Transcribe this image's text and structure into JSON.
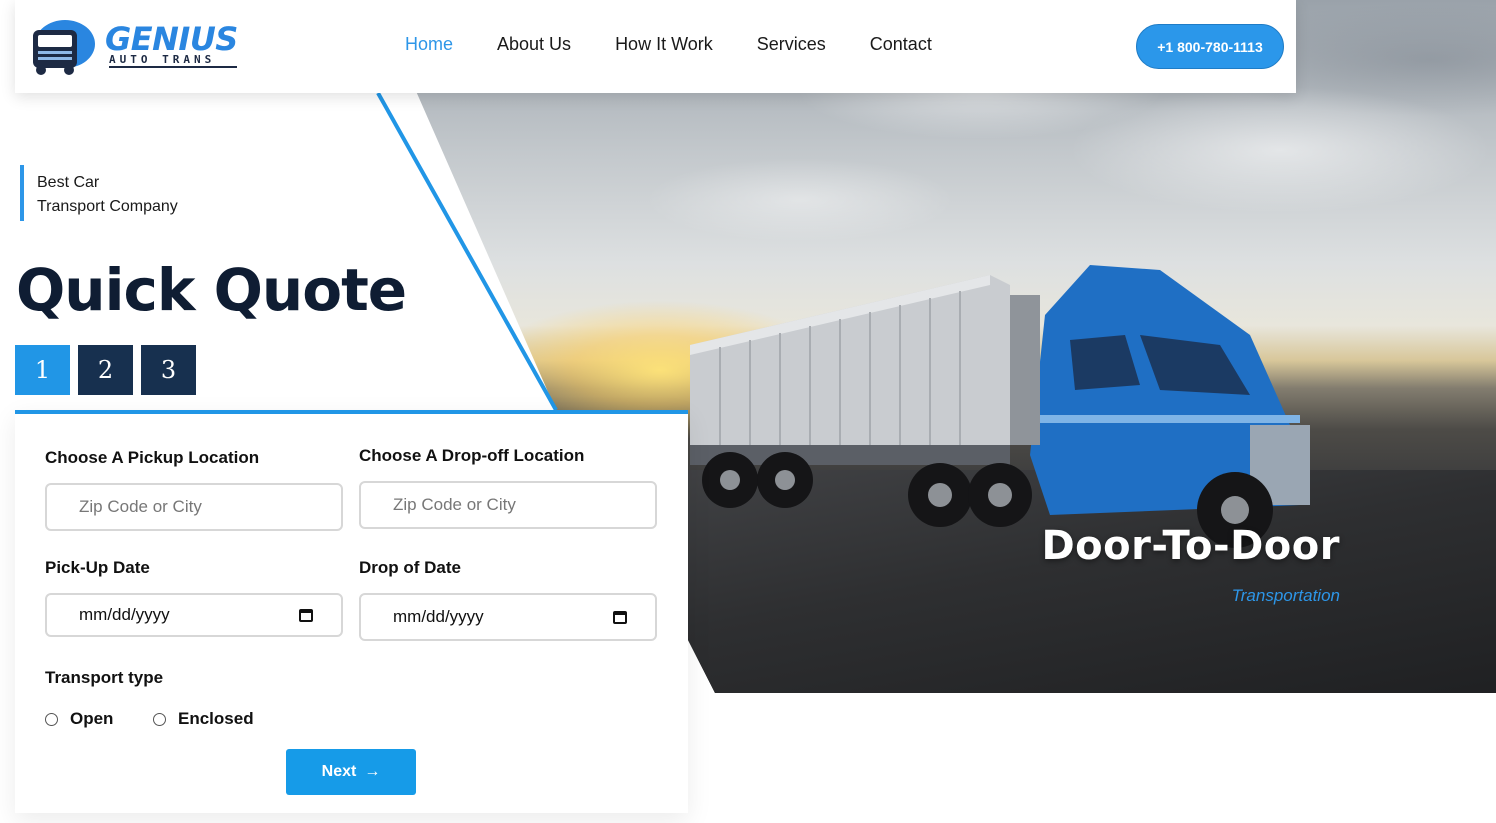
{
  "header": {
    "logo_word": "GENIUS",
    "logo_sub": "AUTO TRANS",
    "nav": [
      {
        "label": "Home",
        "active": true
      },
      {
        "label": "About Us",
        "active": false
      },
      {
        "label": "How It Work",
        "active": false
      },
      {
        "label": "Services",
        "active": false
      },
      {
        "label": "Contact",
        "active": false
      }
    ],
    "phone": "+1 800-780-1113"
  },
  "hero": {
    "tag_line1": "Best Car",
    "tag_line2": "Transport Company",
    "title": "Quick Quote",
    "slide_title": "Door-To-Door",
    "slide_subtitle": "Transportation",
    "steps": [
      "1",
      "2",
      "3"
    ],
    "active_step": "1"
  },
  "form": {
    "pickup_label": "Choose A Pickup Location",
    "pickup_placeholder": "Zip Code  or City",
    "dropoff_label": "Choose A Drop-off Location",
    "dropoff_placeholder": "Zip Code  or City",
    "pickup_date_label": "Pick-Up Date",
    "pickup_date_value": "mm/dd/yyyy",
    "drop_date_label": "Drop of Date",
    "drop_date_value": "mm/dd/yyyy",
    "transport_label": "Transport type",
    "transport_options": [
      "Open",
      "Enclosed"
    ],
    "next_label": "Next",
    "next_arrow": "→"
  },
  "colors": {
    "accent": "#2196e6",
    "navy": "#17304f",
    "title": "#0f1d33"
  }
}
